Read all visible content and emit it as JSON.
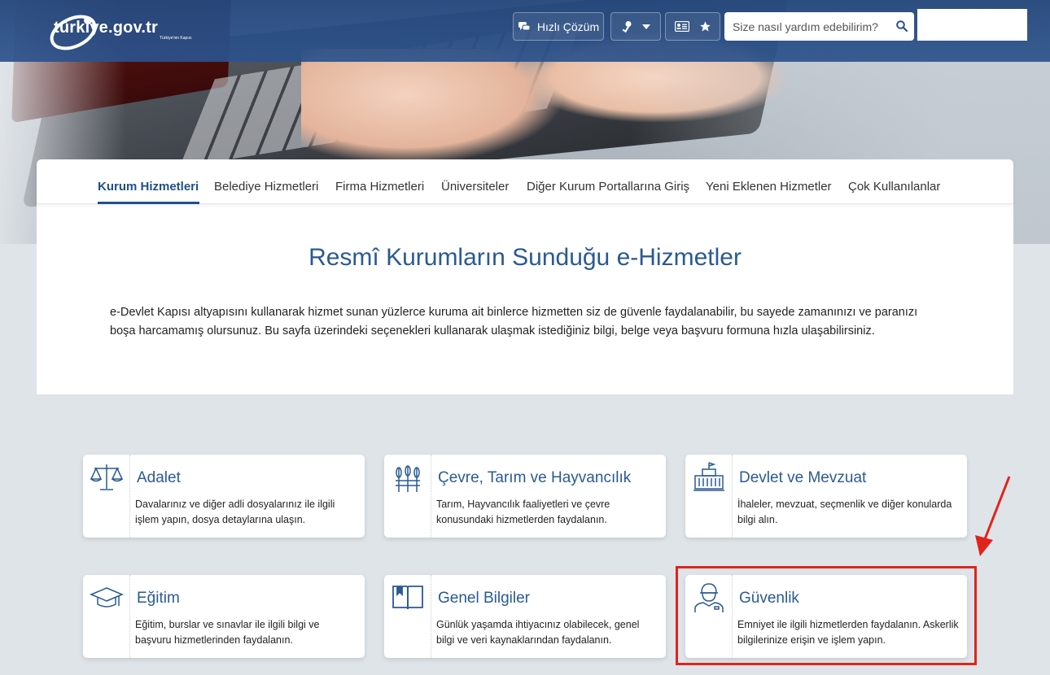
{
  "header": {
    "logo_text": "türkiye.gov.tr",
    "logo_sub": "Türkiye'nin Kapısı",
    "quick_label": "Hızlı Çözüm",
    "search_placeholder": "Size nasıl yardım edebilirim?"
  },
  "tabs": [
    {
      "label": "Kurum Hizmetleri",
      "active": true
    },
    {
      "label": "Belediye Hizmetleri"
    },
    {
      "label": "Firma Hizmetleri"
    },
    {
      "label": "Üniversiteler"
    },
    {
      "label": "Diğer Kurum Portallarına Giriş"
    },
    {
      "label": "Yeni Eklenen Hizmetler"
    },
    {
      "label": "Çok Kullanılanlar"
    }
  ],
  "main": {
    "title": "Resmî Kurumların Sunduğu e-Hizmetler",
    "description": "e-Devlet Kapısı altyapısını kullanarak hizmet sunan yüzlerce kuruma ait binlerce hizmetten siz de güvenle faydalanabilir, bu sayede zamanınızı ve paranızı boşa harcamamış olursunuz. Bu sayfa üzerindeki seçenekleri kullanarak ulaşmak istediğiniz bilgi, belge veya başvuru formuna hızla ulaşabilirsiniz."
  },
  "categories": [
    {
      "title": "Adalet",
      "desc": "Davalarınız ve diğer adli dosyalarınız ile ilgili işlem yapın, dosya detaylarına ulaşın.",
      "icon": "scales-icon"
    },
    {
      "title": "Çevre, Tarım ve Hayvancılık",
      "desc": "Tarım, Hayvancılık faaliyetleri ve çevre konusundaki hizmetlerden faydalanın.",
      "icon": "wheat-icon"
    },
    {
      "title": "Devlet ve Mevzuat",
      "desc": "İhaleler, mevzuat, seçmenlik ve diğer konularda bilgi alın.",
      "icon": "government-building-icon"
    },
    {
      "title": "Eğitim",
      "desc": "Eğitim, burslar ve sınavlar ile ilgili bilgi ve başvuru hizmetlerinden faydalanın.",
      "icon": "graduation-cap-icon"
    },
    {
      "title": "Genel Bilgiler",
      "desc": "Günlük yaşamda ihtiyacınız olabilecek, genel bilgi ve veri kaynaklarından faydalanın.",
      "icon": "open-book-icon"
    },
    {
      "title": "Güvenlik",
      "desc": "Emniyet ile ilgili hizmetlerden faydalanın. Askerlik bilgilerinize erişin ve işlem yapın.",
      "icon": "soldier-icon"
    }
  ],
  "colors": {
    "header": "#2a5290",
    "accent": "#1f4f8a",
    "title": "#2a5a94",
    "highlight": "#e0241c"
  }
}
